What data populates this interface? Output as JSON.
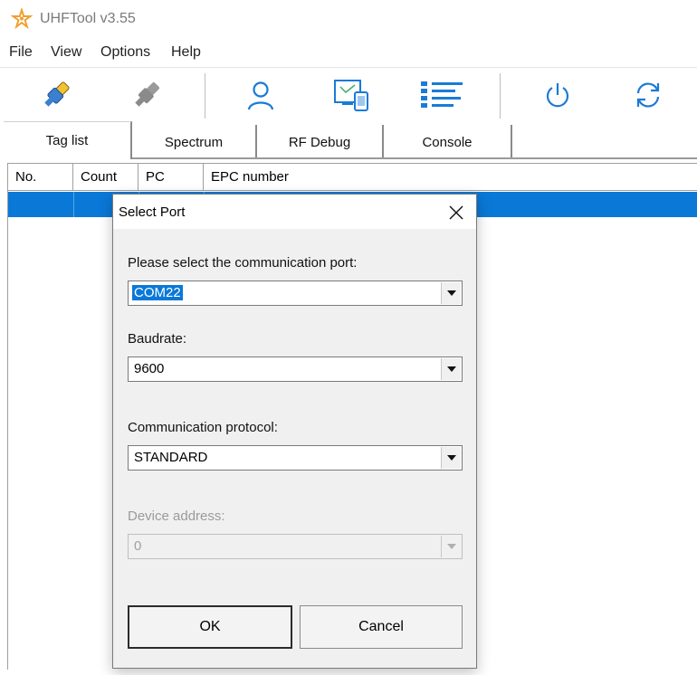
{
  "window": {
    "title": "UHFTool v3.55",
    "icon": "star-logo-icon"
  },
  "menu": [
    "File",
    "View",
    "Options",
    "Help"
  ],
  "toolbar": {
    "buttons": [
      {
        "icon": "connect-plug-icon"
      },
      {
        "icon": "disconnect-plug-icon"
      },
      {
        "icon": "user-icon"
      },
      {
        "icon": "device-monitor-icon"
      },
      {
        "icon": "list-icon"
      },
      {
        "icon": "power-icon"
      },
      {
        "icon": "refresh-icon"
      }
    ]
  },
  "tabs": [
    "Tag list",
    "Spectrum",
    "RF Debug",
    "Console"
  ],
  "active_tab": "Tag list",
  "tag_grid": {
    "columns": [
      "No.",
      "Count",
      "PC",
      "EPC number"
    ],
    "selected_row_color": "#0a78d7"
  },
  "dialog": {
    "title": "Select Port",
    "port_label": "Please select the communication port:",
    "port_value": "COM22",
    "baud_label": "Baudrate:",
    "baud_value": "9600",
    "protocol_label": "Communication protocol:",
    "protocol_value": "STANDARD",
    "address_label": "Device address:",
    "address_value": "0",
    "ok_label": "OK",
    "cancel_label": "Cancel"
  },
  "colors": {
    "accent": "#0a78d7",
    "logo": "#f0a030",
    "toolbar_icon": "#1a7bd6"
  }
}
